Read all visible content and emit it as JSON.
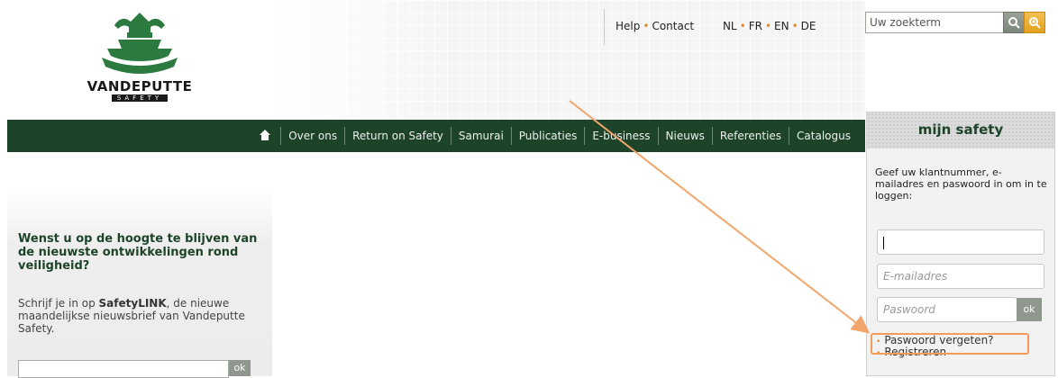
{
  "brand": {
    "name": "VANDEPUTTE",
    "tagline": "SAFETY"
  },
  "top_links": {
    "help": "Help",
    "contact": "Contact",
    "langs": [
      "NL",
      "FR",
      "EN",
      "DE"
    ]
  },
  "search": {
    "placeholder": "Uw zoekterm"
  },
  "nav": {
    "items": [
      "Over ons",
      "Return on Safety",
      "Samurai",
      "Publicaties",
      "E-business",
      "Nieuws",
      "Referenties",
      "Catalogus"
    ]
  },
  "promo": {
    "heading": "Wenst u op de hoogte te blijven van de nieuwste ontwikkelingen rond veiligheid?",
    "text_before": "Schrijf je in op ",
    "text_bold": "SafetyLINK",
    "text_after": ", de nieuwe maandelijkse nieuwsbrief van Vandeputte Safety.",
    "ok_label": "ok"
  },
  "login": {
    "title": "mijn safety",
    "intro": "Geef uw klantnummer, e-mailadres en paswoord in om in te loggen:",
    "email_placeholder": "E-mailadres",
    "password_placeholder": "Paswoord",
    "ok_label": "ok",
    "forgot_label": "Paswoord vergeten?",
    "register_label": "Registreren"
  },
  "colors": {
    "nav_bg": "#1d4429",
    "accent": "#e58a2c",
    "highlight": "#f29b5b"
  }
}
